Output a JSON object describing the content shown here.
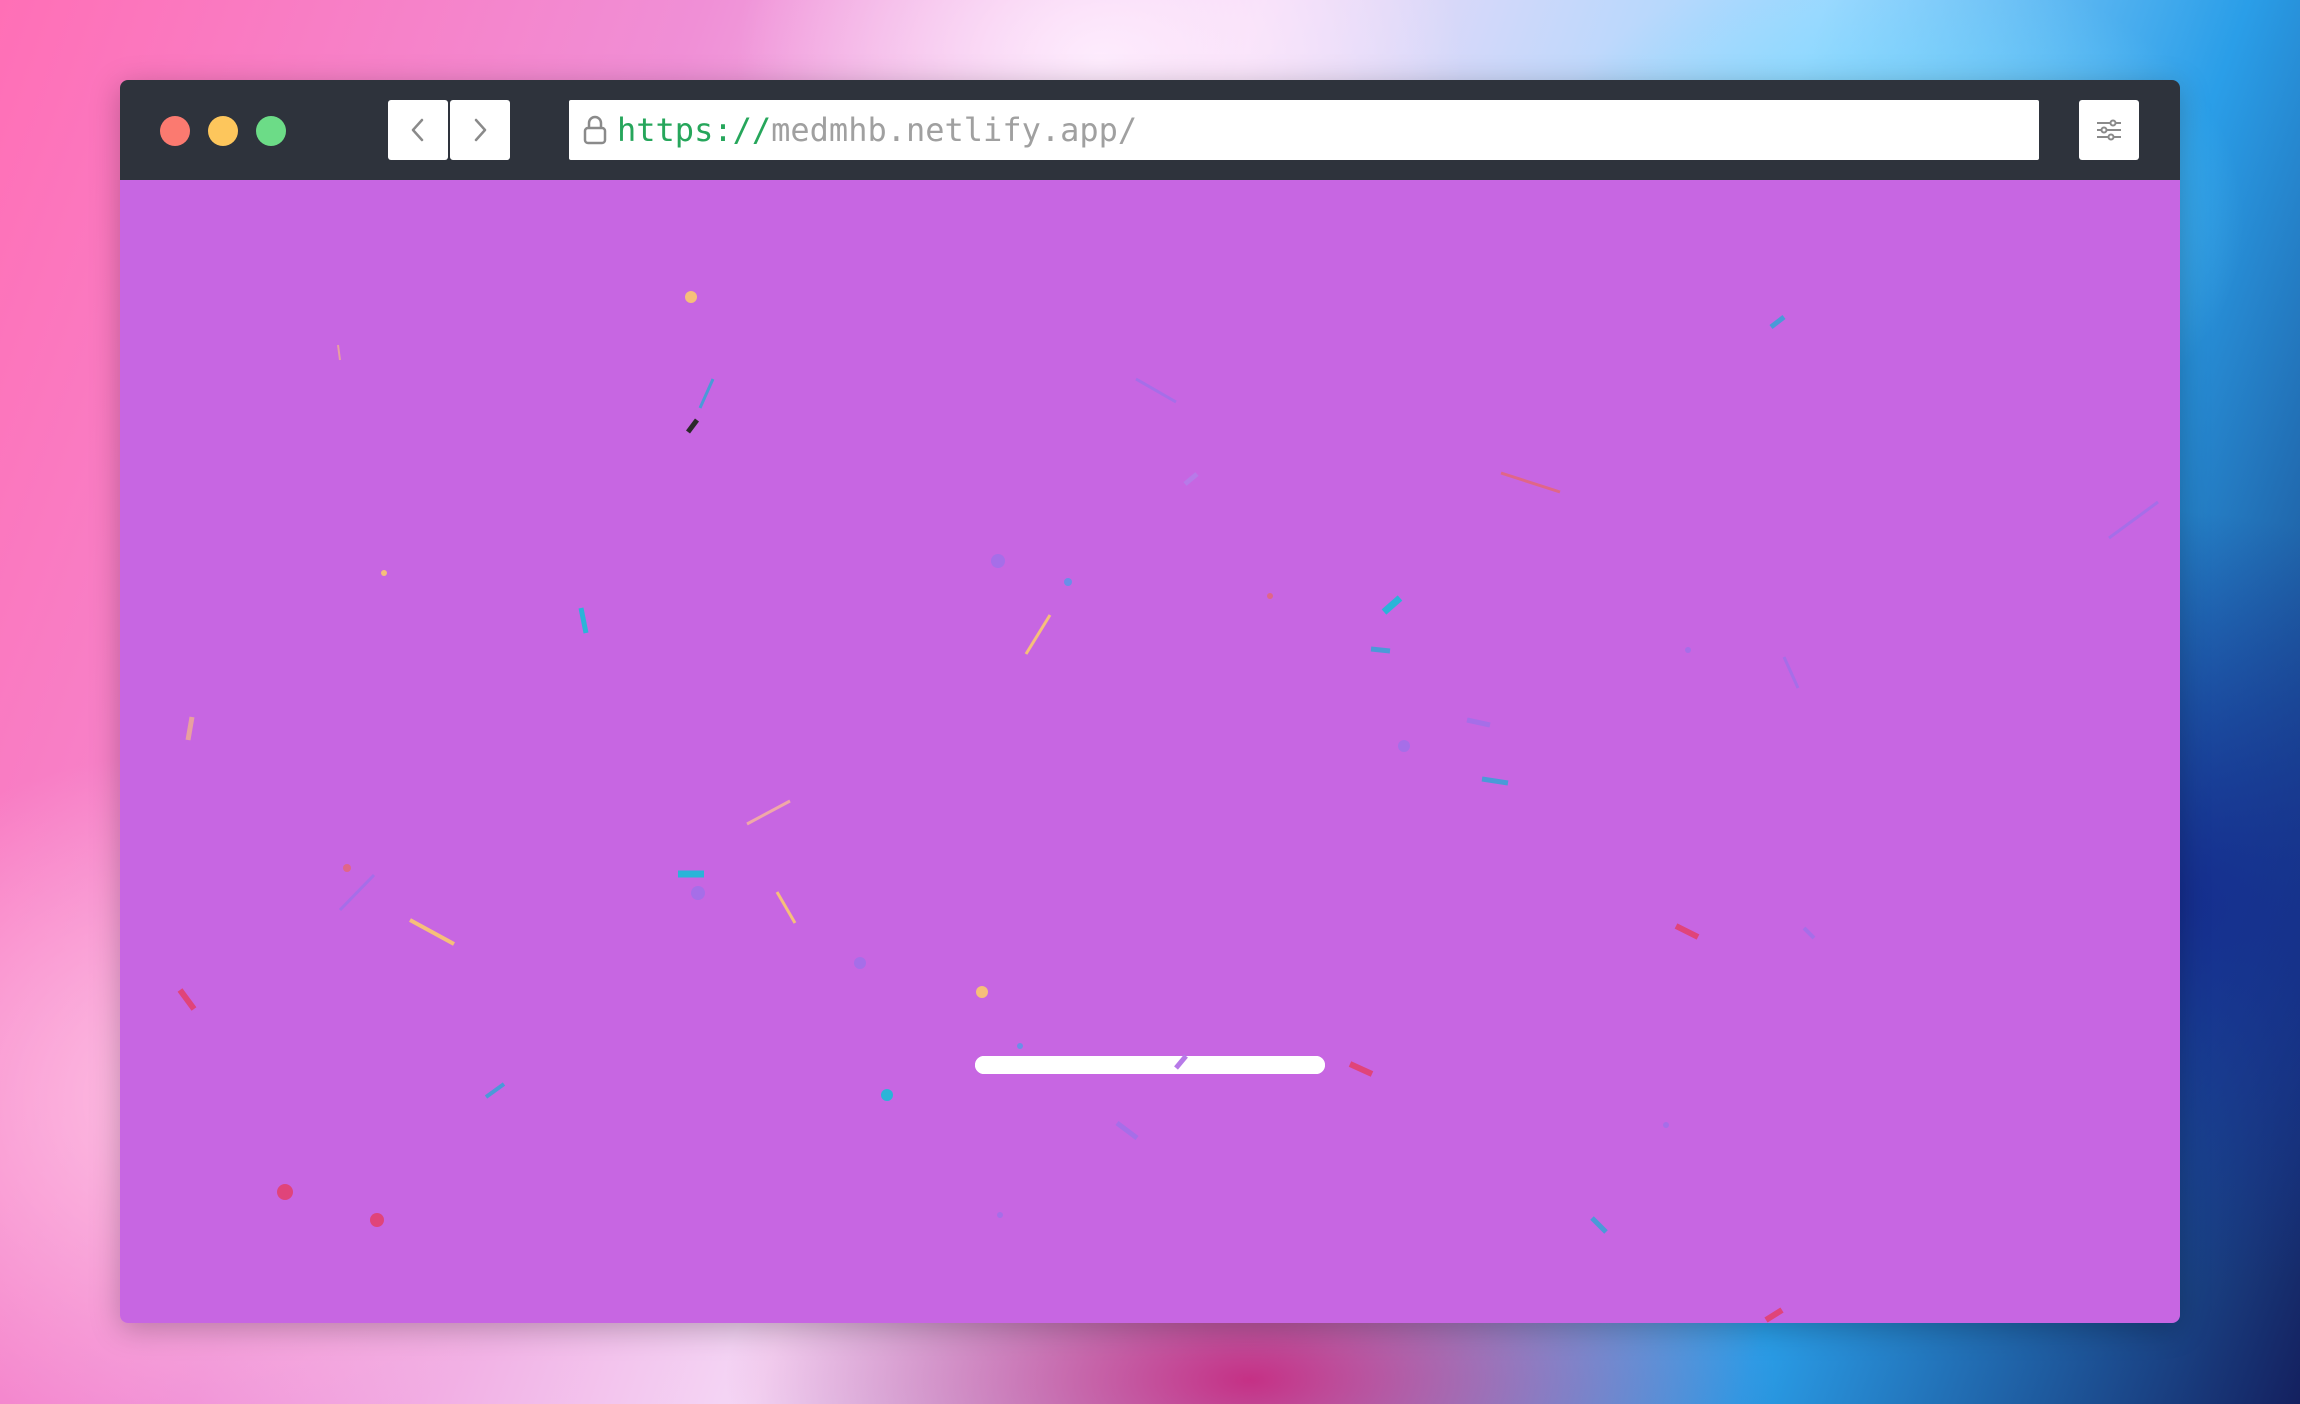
{
  "browser": {
    "url_scheme": "https://",
    "url_rest": "medmhb.netlify.app/",
    "icons": {
      "back": "chevron-left-icon",
      "forward": "chevron-right-icon",
      "lock": "lock-icon",
      "settings": "sliders-icon"
    }
  },
  "page": {
    "background_color": "#c766e2",
    "loader": {
      "progress": 1.0,
      "color": "#ffffff"
    }
  },
  "colors": {
    "traffic_red": "#fb7a70",
    "traffic_yellow": "#fdc65c",
    "traffic_green": "#6cdc87",
    "titlebar": "#2e333c",
    "url_scheme": "#26a65b",
    "url_text": "#a0a0a0"
  }
}
